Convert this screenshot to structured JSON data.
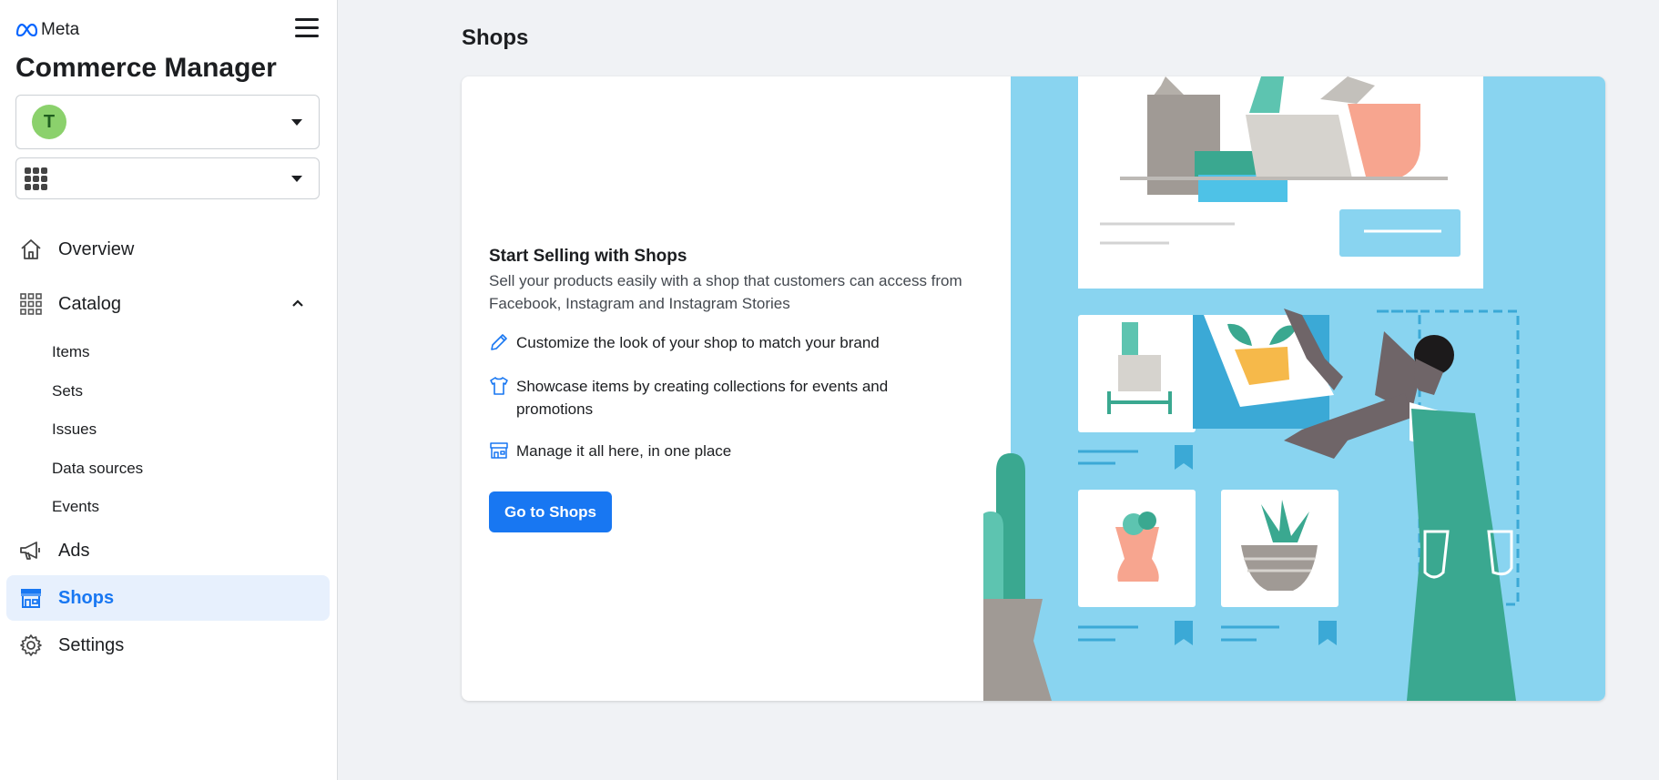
{
  "brand": {
    "logo_text": "Meta",
    "app_title": "Commerce Manager"
  },
  "account_selector": {
    "avatar_letter": "T",
    "label": ""
  },
  "business_selector": {
    "label": ""
  },
  "sidebar": {
    "overview": "Overview",
    "catalog": "Catalog",
    "catalog_items": [
      "Items",
      "Sets",
      "Issues",
      "Data sources",
      "Events"
    ],
    "ads": "Ads",
    "shops": "Shops",
    "settings": "Settings"
  },
  "main": {
    "title": "Shops",
    "card": {
      "heading": "Start Selling with Shops",
      "description": "Sell your products easily with a shop that customers can access from Facebook, Instagram and Instagram Stories",
      "features": [
        "Customize the look of your shop to match your brand",
        "Showcase items by creating collections for events and promotions",
        "Manage it all here, in one place"
      ],
      "cta": "Go to Shops"
    }
  },
  "colors": {
    "accent": "#1877f2",
    "active_bg": "#e7f0fd",
    "illustration_bg": "#89d4f0",
    "avatar": "#8bd16c"
  },
  "icons": [
    "meta-logo-icon",
    "hamburger-icon",
    "chevron-down-icon",
    "apps-grid-icon",
    "home-icon",
    "catalog-grid-icon",
    "chevron-up-icon",
    "megaphone-icon",
    "shop-icon",
    "gear-icon",
    "pencil-icon",
    "shirt-icon",
    "storefront-icon"
  ]
}
